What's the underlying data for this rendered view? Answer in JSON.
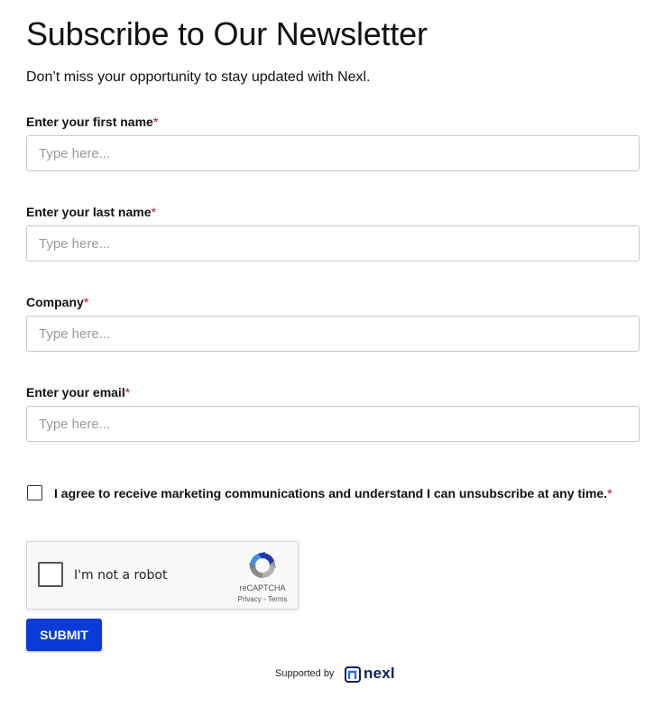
{
  "header": {
    "title": "Subscribe to Our Newsletter",
    "subtitle": "Don’t miss your opportunity to stay updated with Nexl."
  },
  "form": {
    "required_marker": "*",
    "fields": [
      {
        "label": "Enter your first name",
        "placeholder": "Type here...",
        "value": ""
      },
      {
        "label": "Enter your last name",
        "placeholder": "Type here...",
        "value": ""
      },
      {
        "label": "Company",
        "placeholder": "Type here...",
        "value": ""
      },
      {
        "label": "Enter your email",
        "placeholder": "Type here...",
        "value": ""
      }
    ],
    "consent": {
      "text": "I agree to receive marketing communications and understand I can unsubscribe at any time.",
      "checked": false
    },
    "submit_label": "SUBMIT"
  },
  "captcha": {
    "label": "I'm not a robot",
    "brand": "reCAPTCHA",
    "links": "Privacy - Terms",
    "icon": "recaptcha-logo-icon"
  },
  "footer": {
    "supported_by": "Supported by",
    "brand": "nexl",
    "icon": "nexl-logo-icon"
  },
  "colors": {
    "accent": "#0a3bd8",
    "required": "#d0021b",
    "brand_dark": "#0b1f5c"
  }
}
